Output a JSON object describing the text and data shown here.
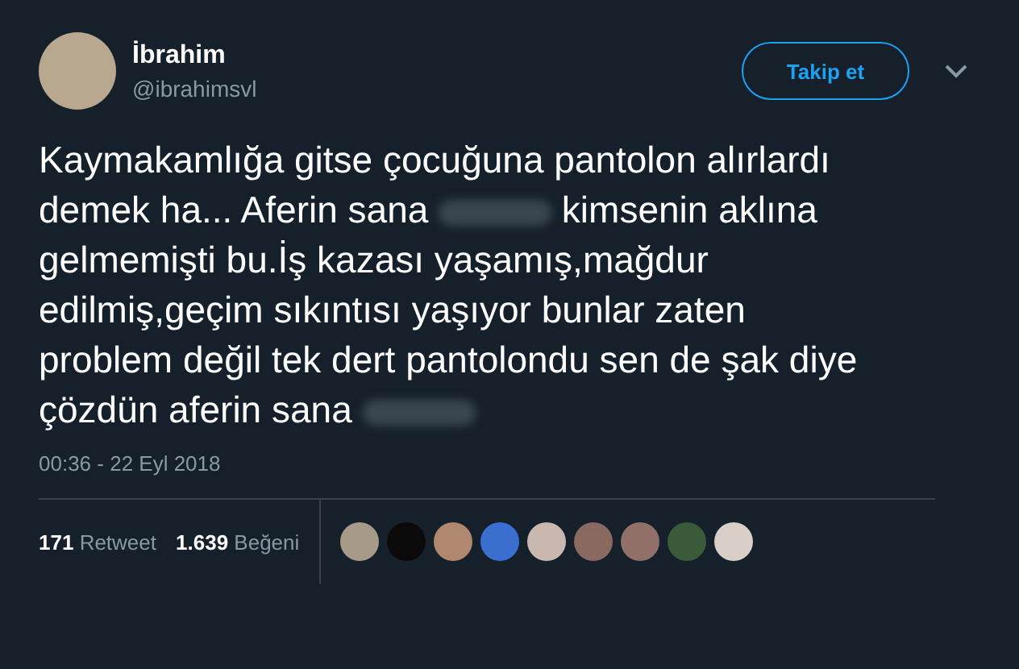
{
  "author": {
    "name": "İbrahim",
    "handle": "@ibrahimsvl"
  },
  "follow_button": "Takip et",
  "tweet_text": [
    {
      "kind": "text",
      "text": "Kaymakamlığa gitse çocuğuna pantolon alırlardı demek ha... Aferin sana "
    },
    {
      "kind": "blur"
    },
    {
      "kind": "text",
      "text": " kimsenin aklına gelmemişti bu.İş kazası yaşamış,mağdur edilmiş,geçim sıkıntısı yaşıyor bunlar zaten problem değil tek dert pantolondu sen de şak diye çözdün aferin sana "
    },
    {
      "kind": "blur"
    }
  ],
  "timestamp": "00:36 - 22 Eyl 2018",
  "stats": [
    {
      "count": "171",
      "label": "Retweet"
    },
    {
      "count": "1.639",
      "label": "Beğeni"
    }
  ],
  "liker_avatars": [
    {
      "color": "#a89a88"
    },
    {
      "color": "#0a0a0a"
    },
    {
      "color": "#b08870"
    },
    {
      "color": "#3a6fd0"
    },
    {
      "color": "#c8b8b0"
    },
    {
      "color": "#8a6a60"
    },
    {
      "color": "#907068"
    },
    {
      "color": "#3a5a3a"
    },
    {
      "color": "#d8d0c8"
    }
  ]
}
